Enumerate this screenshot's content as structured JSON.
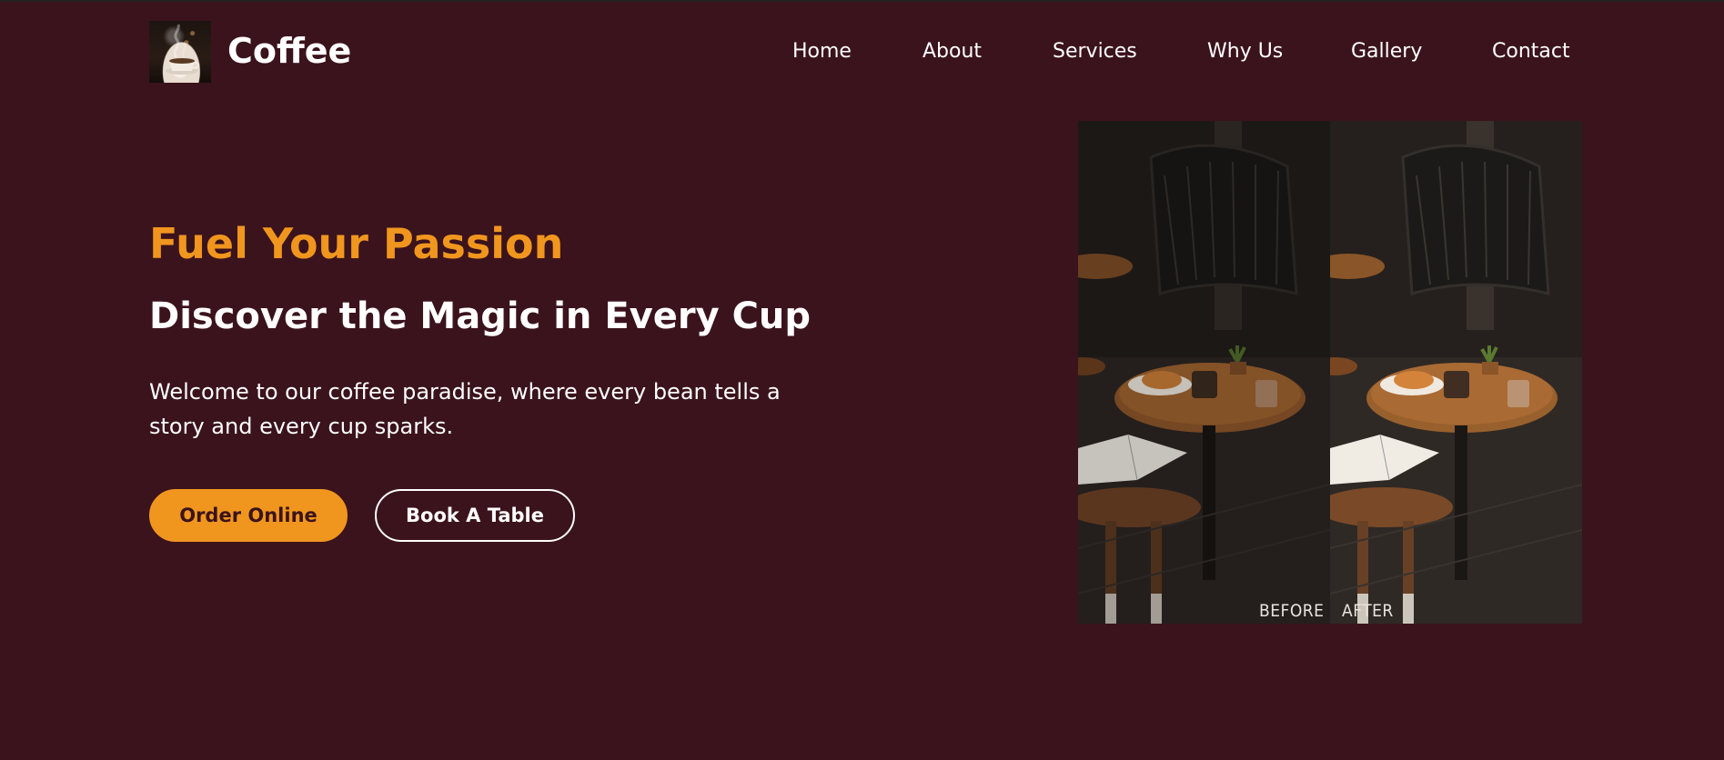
{
  "header": {
    "brand": "Coffee",
    "logo_icon": "coffee-cup-steam-icon",
    "nav": [
      "Home",
      "About",
      "Services",
      "Why Us",
      "Gallery",
      "Contact"
    ]
  },
  "hero": {
    "tagline": "Fuel Your Passion",
    "title": "Discover the Magic in Every Cup",
    "description": "Welcome to our coffee paradise, where every bean tells a story and every cup sparks.",
    "order_label": "Order Online",
    "book_label": "Book A Table"
  },
  "comparison": {
    "before_label": "BEFORE",
    "after_label": "AFTER"
  },
  "colors": {
    "background": "#3b131c",
    "accent": "#f0961f",
    "text": "#ffffff"
  }
}
